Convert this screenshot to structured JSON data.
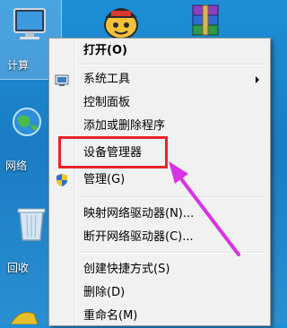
{
  "desktop": {
    "icons": [
      {
        "label": "计算",
        "icon": "computer-icon"
      },
      {
        "label": "网络",
        "icon": "network-icon"
      },
      {
        "label": "回收",
        "icon": "recycle-bin-icon"
      }
    ],
    "top_icons": [
      {
        "icon": "game-character-icon"
      },
      {
        "icon": "winrar-archive-icon"
      }
    ]
  },
  "context_menu": {
    "items": [
      {
        "label": "打开(O)",
        "bold": true
      },
      {
        "label": "系统工具",
        "submenu": true
      },
      {
        "label": "控制面板"
      },
      {
        "label": "添加或删除程序"
      },
      {
        "label": "设备管理器"
      },
      {
        "label": "管理(G)",
        "icon": "uac-shield-icon"
      },
      {
        "label": "映射网络驱动器(N)..."
      },
      {
        "label": "断开网络驱动器(C)..."
      },
      {
        "label": "创建快捷方式(S)"
      },
      {
        "label": "删除(D)"
      },
      {
        "label": "重命名(M)"
      }
    ]
  },
  "annotation": {
    "highlight_color": "#e8242a",
    "arrow_color": "#d832e6"
  }
}
